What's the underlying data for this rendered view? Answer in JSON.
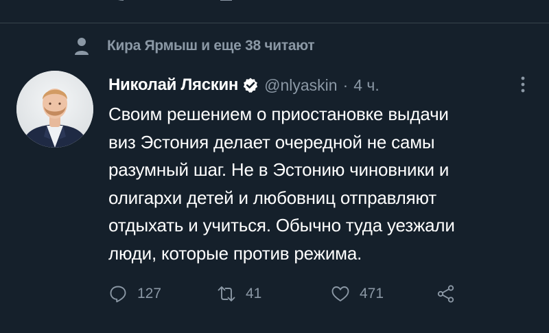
{
  "social_context": {
    "text": "Кира Ярмыш и еще 38 читают",
    "icon": "person-icon"
  },
  "tweet": {
    "author": {
      "name": "Николай Ляскин",
      "handle": "@nlyaskin",
      "verified": true,
      "avatar": "avatar"
    },
    "separator": "·",
    "time": "4 ч.",
    "text_lines": [
      "Своим решением о приостановке выдачи",
      "виз Эстония делает очередной не самы",
      "разумный шаг. Не в Эстонию чиновники и",
      "олигархи детей и любовниц отправляют",
      "отдыхать и учиться. Обычно туда уезжали",
      "люди, которые против режима."
    ],
    "actions": {
      "reply_count": "127",
      "retweet_count": "41",
      "like_count": "471"
    }
  },
  "colors": {
    "background": "#15202b",
    "text_primary": "#ffffff",
    "text_secondary": "#8b98a5",
    "divider": "#38444d",
    "verified_badge": "#ffffff"
  }
}
